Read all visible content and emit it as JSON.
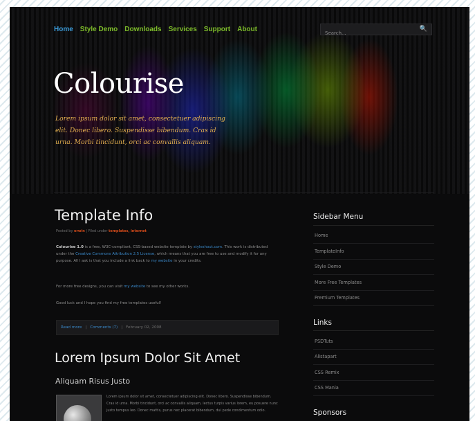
{
  "nav": {
    "items": [
      "Home",
      "Style Demo",
      "Downloads",
      "Services",
      "Support",
      "About"
    ],
    "active": "Home",
    "active_color": "#3a9ad8",
    "color": "#7dbb2a"
  },
  "search": {
    "placeholder": "Search...",
    "icon": "search-icon"
  },
  "header": {
    "title": "Colourise",
    "tagline": "Lorem ipsum dolor sit amet, consectetuer adipiscing elit. Donec libero. Suspendisse bibendum. Cras id urna. Morbi tincidunt, orci ac convallis aliquam."
  },
  "post1": {
    "title": "Template Info",
    "meta_prefix": "Posted by",
    "meta_author": "erwin",
    "meta_middle": "| Filed under",
    "meta_tags": "templates, internet",
    "p1_bold": "Colourise 1.0",
    "p1_a": "is a free, W3C-compliant, CSS-based website template by",
    "p1_link1": "styleshout.com",
    "p1_b": ". This work is distributed under the",
    "p1_link2": "Creative Commons Attribution 2.5 License",
    "p1_c": ", which means that you are free to use and modify it for any purpose. All I ask is that you include a link back to",
    "p1_link3": "my website",
    "p1_d": "in your credits.",
    "p2_a": "For more free designs, you can visit",
    "p2_link": "my website",
    "p2_b": "to see my other works.",
    "p3": "Good luck and I hope you find my free templates useful!",
    "read_more": "Read more",
    "comments": "Comments (7)",
    "date": "February 02, 2008"
  },
  "post2": {
    "title": "Lorem Ipsum Dolor Sit Amet",
    "subtitle": "Aliquam Risus Justo",
    "excerpt": "Lorem ipsum dolor sit amet, consectetuer adipiscing elit. Donec libero. Suspendisse bibendum. Cras id urna. Morbi tincidunt, orci ac convallis aliquam, lectus turpis varius lorem, eu posuere nunc justo tempus leo. Donec mattis, purus nec placerat bibendum, dui pede condimentum odio."
  },
  "sidebar": {
    "menu_title": "Sidebar Menu",
    "menu": [
      "Home",
      "TemplateInfo",
      "Style Demo",
      "More Free Templates",
      "Premium Templates"
    ],
    "links_title": "Links",
    "links": [
      "PSDTuts",
      "Alistapart",
      "CSS Remix",
      "CSS Mania"
    ],
    "sponsors_title": "Sponsors"
  }
}
